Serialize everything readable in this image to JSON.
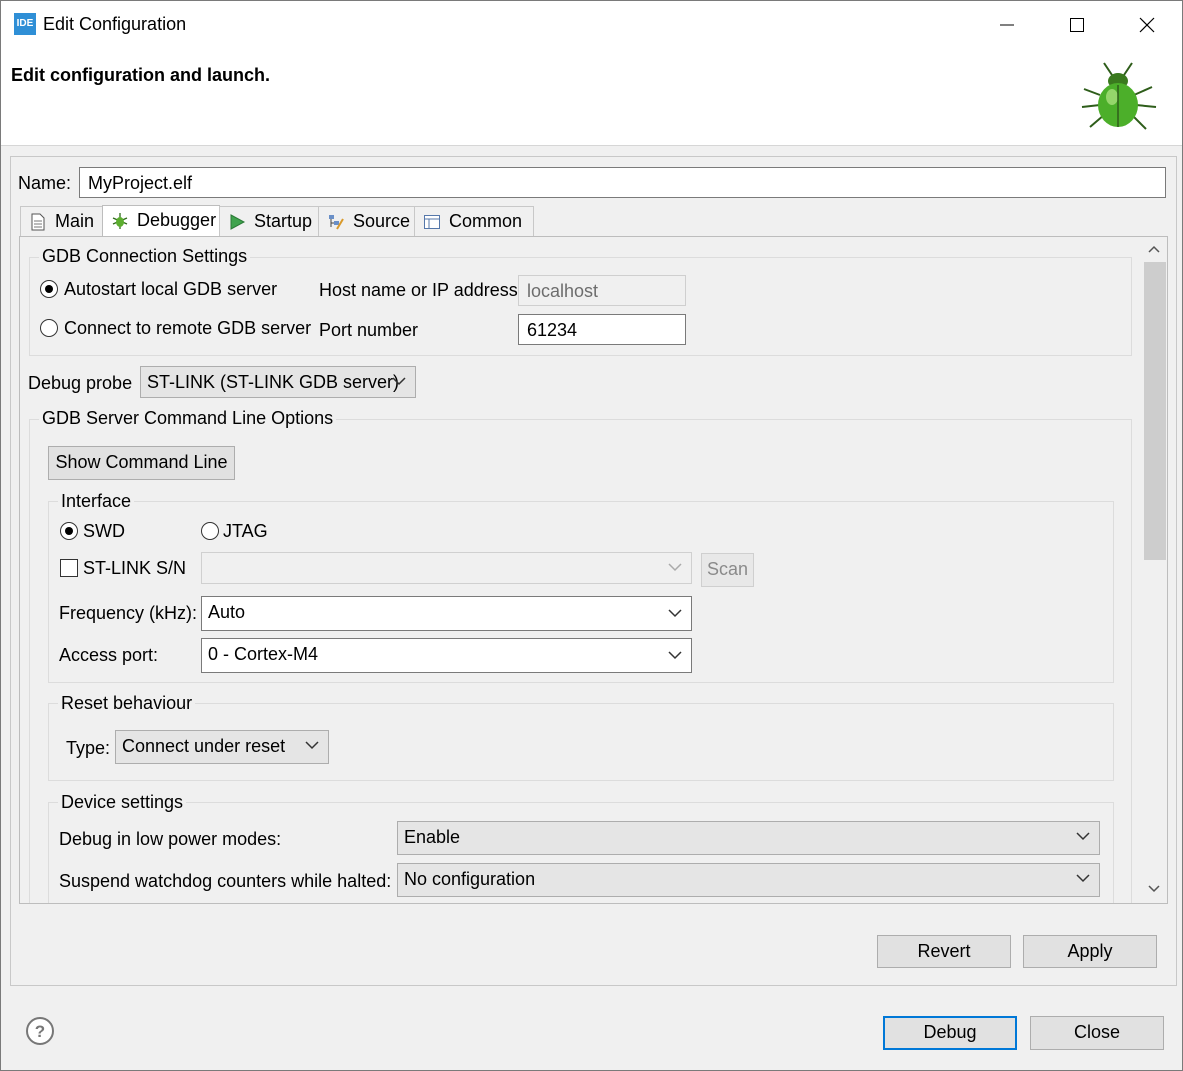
{
  "window": {
    "icon_text": "IDE",
    "title": "Edit Configuration",
    "header_title": "Edit configuration and launch."
  },
  "name_field": {
    "label": "Name:",
    "value": "MyProject.elf"
  },
  "tabs": [
    {
      "label": "Main",
      "icon": "document-icon"
    },
    {
      "label": "Debugger",
      "icon": "bug-icon"
    },
    {
      "label": "Startup",
      "icon": "play-icon"
    },
    {
      "label": "Source",
      "icon": "source-icon"
    },
    {
      "label": "Common",
      "icon": "table-icon"
    }
  ],
  "gdb_connection": {
    "title": "GDB Connection Settings",
    "autostart_label": "Autostart local GDB server",
    "remote_label": "Connect to remote GDB server",
    "host_label": "Host name or IP address",
    "host_value": "localhost",
    "port_label": "Port number",
    "port_value": "61234",
    "selected": "autostart"
  },
  "debug_probe": {
    "label": "Debug probe",
    "value": "ST-LINK (ST-LINK GDB server)"
  },
  "gdb_server_options": {
    "title": "GDB Server Command Line Options",
    "show_command_line": "Show Command Line"
  },
  "interface": {
    "title": "Interface",
    "swd_label": "SWD",
    "jtag_label": "JTAG",
    "selected": "SWD",
    "stlink_sn_label": "ST-LINK S/N",
    "stlink_sn_checked": false,
    "scan_label": "Scan",
    "frequency_label": "Frequency (kHz):",
    "frequency_value": "Auto",
    "access_port_label": "Access port:",
    "access_port_value": "0 - Cortex-M4"
  },
  "reset": {
    "title": "Reset behaviour",
    "type_label": "Type:",
    "type_value": "Connect under reset"
  },
  "device_settings": {
    "title": "Device settings",
    "low_power_label": "Debug in low power modes:",
    "low_power_value": "Enable",
    "watchdog_label": "Suspend watchdog counters while halted:",
    "watchdog_value": "No configuration"
  },
  "buttons": {
    "revert": "Revert",
    "apply": "Apply",
    "debug": "Debug",
    "close": "Close"
  }
}
